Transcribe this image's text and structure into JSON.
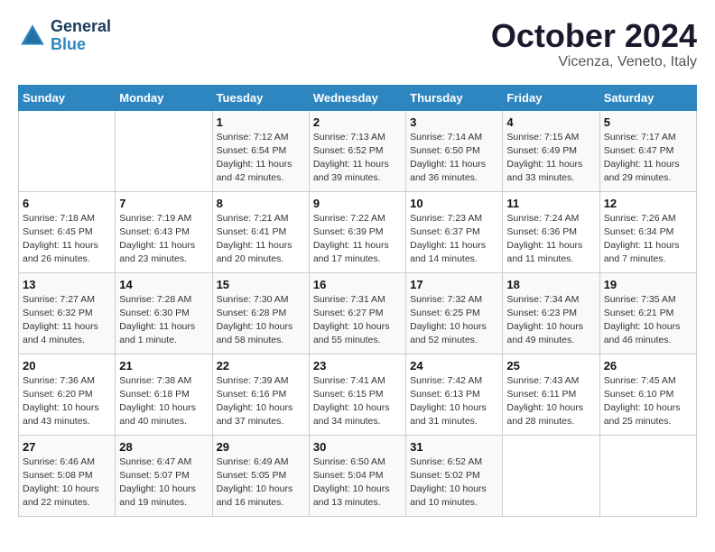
{
  "header": {
    "logo_general": "General",
    "logo_blue": "Blue",
    "month": "October 2024",
    "location": "Vicenza, Veneto, Italy"
  },
  "weekdays": [
    "Sunday",
    "Monday",
    "Tuesday",
    "Wednesday",
    "Thursday",
    "Friday",
    "Saturday"
  ],
  "weeks": [
    [
      {
        "day": "",
        "info": ""
      },
      {
        "day": "",
        "info": ""
      },
      {
        "day": "1",
        "info": "Sunrise: 7:12 AM\nSunset: 6:54 PM\nDaylight: 11 hours and 42 minutes."
      },
      {
        "day": "2",
        "info": "Sunrise: 7:13 AM\nSunset: 6:52 PM\nDaylight: 11 hours and 39 minutes."
      },
      {
        "day": "3",
        "info": "Sunrise: 7:14 AM\nSunset: 6:50 PM\nDaylight: 11 hours and 36 minutes."
      },
      {
        "day": "4",
        "info": "Sunrise: 7:15 AM\nSunset: 6:49 PM\nDaylight: 11 hours and 33 minutes."
      },
      {
        "day": "5",
        "info": "Sunrise: 7:17 AM\nSunset: 6:47 PM\nDaylight: 11 hours and 29 minutes."
      }
    ],
    [
      {
        "day": "6",
        "info": "Sunrise: 7:18 AM\nSunset: 6:45 PM\nDaylight: 11 hours and 26 minutes."
      },
      {
        "day": "7",
        "info": "Sunrise: 7:19 AM\nSunset: 6:43 PM\nDaylight: 11 hours and 23 minutes."
      },
      {
        "day": "8",
        "info": "Sunrise: 7:21 AM\nSunset: 6:41 PM\nDaylight: 11 hours and 20 minutes."
      },
      {
        "day": "9",
        "info": "Sunrise: 7:22 AM\nSunset: 6:39 PM\nDaylight: 11 hours and 17 minutes."
      },
      {
        "day": "10",
        "info": "Sunrise: 7:23 AM\nSunset: 6:37 PM\nDaylight: 11 hours and 14 minutes."
      },
      {
        "day": "11",
        "info": "Sunrise: 7:24 AM\nSunset: 6:36 PM\nDaylight: 11 hours and 11 minutes."
      },
      {
        "day": "12",
        "info": "Sunrise: 7:26 AM\nSunset: 6:34 PM\nDaylight: 11 hours and 7 minutes."
      }
    ],
    [
      {
        "day": "13",
        "info": "Sunrise: 7:27 AM\nSunset: 6:32 PM\nDaylight: 11 hours and 4 minutes."
      },
      {
        "day": "14",
        "info": "Sunrise: 7:28 AM\nSunset: 6:30 PM\nDaylight: 11 hours and 1 minute."
      },
      {
        "day": "15",
        "info": "Sunrise: 7:30 AM\nSunset: 6:28 PM\nDaylight: 10 hours and 58 minutes."
      },
      {
        "day": "16",
        "info": "Sunrise: 7:31 AM\nSunset: 6:27 PM\nDaylight: 10 hours and 55 minutes."
      },
      {
        "day": "17",
        "info": "Sunrise: 7:32 AM\nSunset: 6:25 PM\nDaylight: 10 hours and 52 minutes."
      },
      {
        "day": "18",
        "info": "Sunrise: 7:34 AM\nSunset: 6:23 PM\nDaylight: 10 hours and 49 minutes."
      },
      {
        "day": "19",
        "info": "Sunrise: 7:35 AM\nSunset: 6:21 PM\nDaylight: 10 hours and 46 minutes."
      }
    ],
    [
      {
        "day": "20",
        "info": "Sunrise: 7:36 AM\nSunset: 6:20 PM\nDaylight: 10 hours and 43 minutes."
      },
      {
        "day": "21",
        "info": "Sunrise: 7:38 AM\nSunset: 6:18 PM\nDaylight: 10 hours and 40 minutes."
      },
      {
        "day": "22",
        "info": "Sunrise: 7:39 AM\nSunset: 6:16 PM\nDaylight: 10 hours and 37 minutes."
      },
      {
        "day": "23",
        "info": "Sunrise: 7:41 AM\nSunset: 6:15 PM\nDaylight: 10 hours and 34 minutes."
      },
      {
        "day": "24",
        "info": "Sunrise: 7:42 AM\nSunset: 6:13 PM\nDaylight: 10 hours and 31 minutes."
      },
      {
        "day": "25",
        "info": "Sunrise: 7:43 AM\nSunset: 6:11 PM\nDaylight: 10 hours and 28 minutes."
      },
      {
        "day": "26",
        "info": "Sunrise: 7:45 AM\nSunset: 6:10 PM\nDaylight: 10 hours and 25 minutes."
      }
    ],
    [
      {
        "day": "27",
        "info": "Sunrise: 6:46 AM\nSunset: 5:08 PM\nDaylight: 10 hours and 22 minutes."
      },
      {
        "day": "28",
        "info": "Sunrise: 6:47 AM\nSunset: 5:07 PM\nDaylight: 10 hours and 19 minutes."
      },
      {
        "day": "29",
        "info": "Sunrise: 6:49 AM\nSunset: 5:05 PM\nDaylight: 10 hours and 16 minutes."
      },
      {
        "day": "30",
        "info": "Sunrise: 6:50 AM\nSunset: 5:04 PM\nDaylight: 10 hours and 13 minutes."
      },
      {
        "day": "31",
        "info": "Sunrise: 6:52 AM\nSunset: 5:02 PM\nDaylight: 10 hours and 10 minutes."
      },
      {
        "day": "",
        "info": ""
      },
      {
        "day": "",
        "info": ""
      }
    ]
  ]
}
